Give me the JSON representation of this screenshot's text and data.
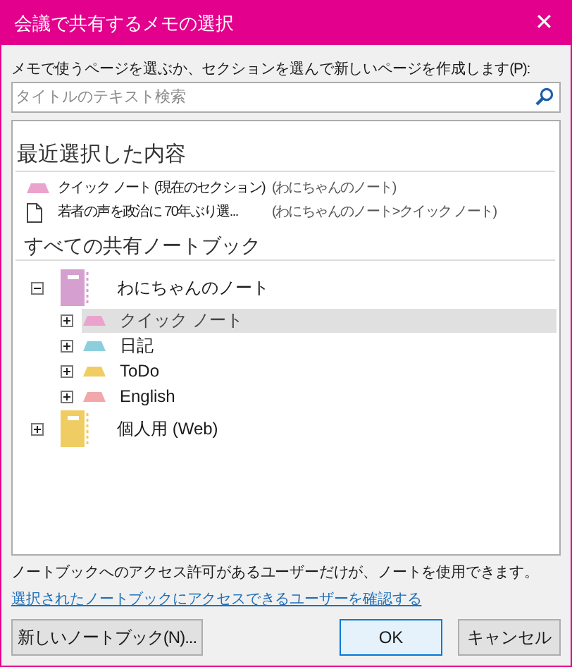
{
  "window": {
    "title": "会議で共有するメモの選択",
    "close": "✕"
  },
  "instruction": "メモで使うページを選ぶか、セクションを選んで新しいページを作成します(P):",
  "search": {
    "placeholder": "タイトルのテキスト検索"
  },
  "recent": {
    "heading": "最近選択した内容",
    "items": [
      {
        "kind": "section",
        "title": "クイック ノート (現在のセクション)",
        "location": "(わにちゃんのノート)",
        "color": "#eba3cd"
      },
      {
        "kind": "page",
        "title": "若者の声を政治に  70年ぶり選...",
        "location": "(わにちゃんのノート>クイック ノート)"
      }
    ]
  },
  "shared": {
    "heading": "すべての共有ノートブック",
    "notebooks": [
      {
        "name": "わにちゃんのノート",
        "expanded": true,
        "color": "#d59fd0",
        "children": [
          {
            "name": "クイック ノート",
            "color": "#eba3cd",
            "selected": true
          },
          {
            "name": "日記",
            "color": "#8ccfdc",
            "selected": false
          },
          {
            "name": "ToDo",
            "color": "#f0cd63",
            "selected": false
          },
          {
            "name": "English",
            "color": "#f0a8aa",
            "selected": false
          }
        ]
      },
      {
        "name": "個人用 (Web)",
        "expanded": false,
        "color": "#f0cd63"
      }
    ]
  },
  "access_note": "ノートブックへのアクセス許可があるユーザーだけが、ノートを使用できます。",
  "access_link": "選択されたノートブックにアクセスできるユーザーを確認する",
  "buttons": [
    {
      "kind": "new",
      "label": "新しいノートブック(N)..."
    },
    {
      "kind": "ok",
      "label": "OK"
    },
    {
      "kind": "cancel",
      "label": "キャンセル"
    }
  ]
}
